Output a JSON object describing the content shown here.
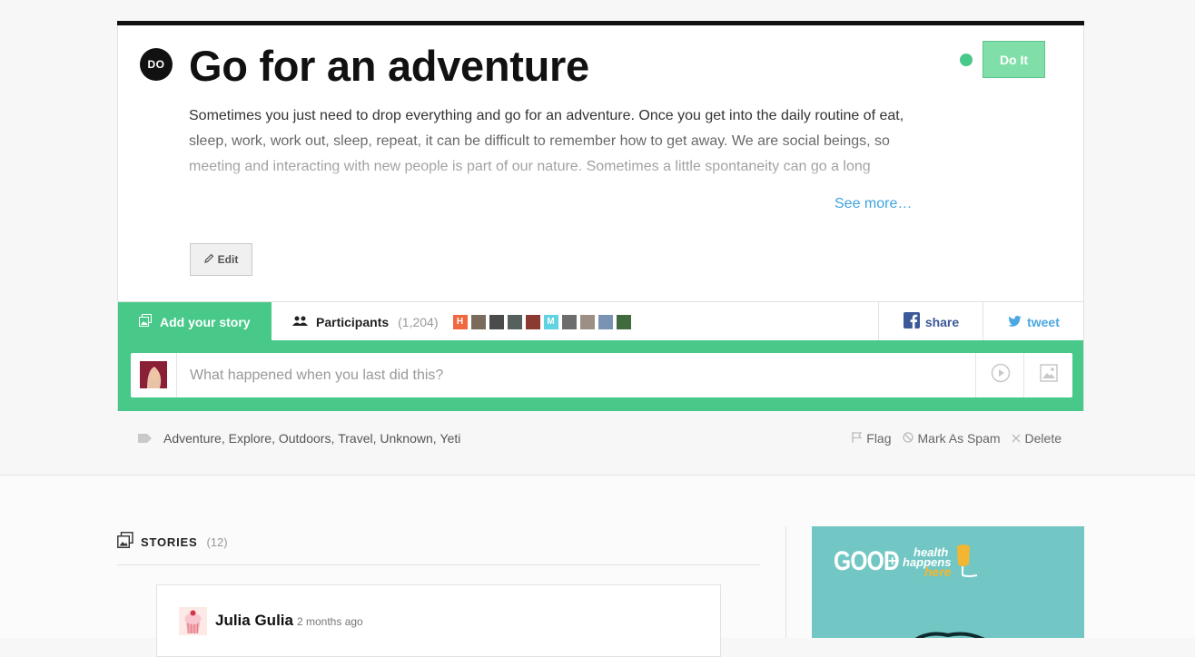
{
  "badge": "DO",
  "title": "Go for an adventure",
  "do_it_label": "Do It",
  "description": "Sometimes you just need to drop everything and go for an adventure. Once you get into the daily routine of eat, sleep, work, work out, sleep, repeat, it can be difficult to remember how to get away. We are social beings, so meeting and interacting with new people is part of our nature. Sometimes a little spontaneity can go a long",
  "see_more": "See more…",
  "edit_label": "Edit",
  "tabs": {
    "add_story": "Add your story",
    "participants": "Participants",
    "participants_count": "(1,204)"
  },
  "participant_avatars": [
    {
      "letter": "H",
      "color": "#f0683f"
    },
    {
      "letter": "",
      "color": "#7a6b5d"
    },
    {
      "letter": "",
      "color": "#4b4b4b"
    },
    {
      "letter": "",
      "color": "#56605c"
    },
    {
      "letter": "",
      "color": "#8a3a32"
    },
    {
      "letter": "M",
      "color": "#5fd3e0"
    },
    {
      "letter": "",
      "color": "#6d6d6d"
    },
    {
      "letter": "",
      "color": "#9d8e86"
    },
    {
      "letter": "",
      "color": "#7b93b3"
    },
    {
      "letter": "",
      "color": "#3f6b3e"
    }
  ],
  "social": {
    "share": "share",
    "tweet": "tweet"
  },
  "story_input": {
    "placeholder": "What happened when you last did this?"
  },
  "tags": [
    "Adventure",
    "Explore",
    "Outdoors",
    "Travel",
    "Unknown",
    "Yeti"
  ],
  "actions": {
    "flag": "Flag",
    "spam": "Mark As Spam",
    "delete": "Delete"
  },
  "stories": {
    "title": "STORIES",
    "count": "(12)",
    "first": {
      "author": "Julia Gulia",
      "time": "2 months ago"
    }
  },
  "ad": {
    "good": "GOOD",
    "plus": "+",
    "health": "health",
    "happens": "happens",
    "here": "here"
  },
  "colors": {
    "accent": "#48c98a",
    "do_it_button": "#80dfa8",
    "link": "#3ea3de",
    "facebook": "#3b5998",
    "twitter": "#4aa7e0"
  }
}
